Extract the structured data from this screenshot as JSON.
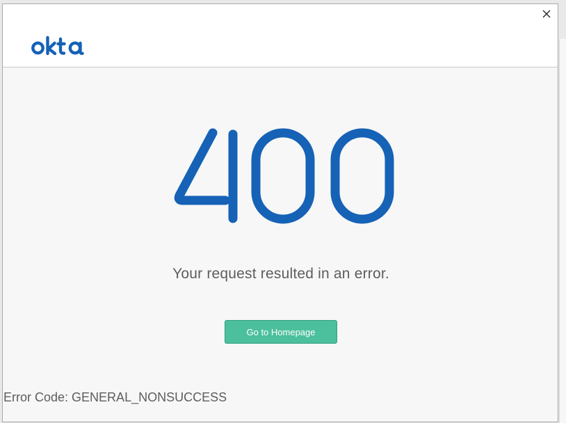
{
  "window": {
    "close_icon": "close-icon"
  },
  "header": {
    "logo_text": "okta",
    "brand_color": "#1662b6"
  },
  "error": {
    "status_code": "400",
    "message": "Your request resulted in an error.",
    "button_label": "Go to Homepage",
    "button_color": "#4cbf9c",
    "code_label": "Error Code:",
    "code_value": "GENERAL_NONSUCCESS"
  }
}
